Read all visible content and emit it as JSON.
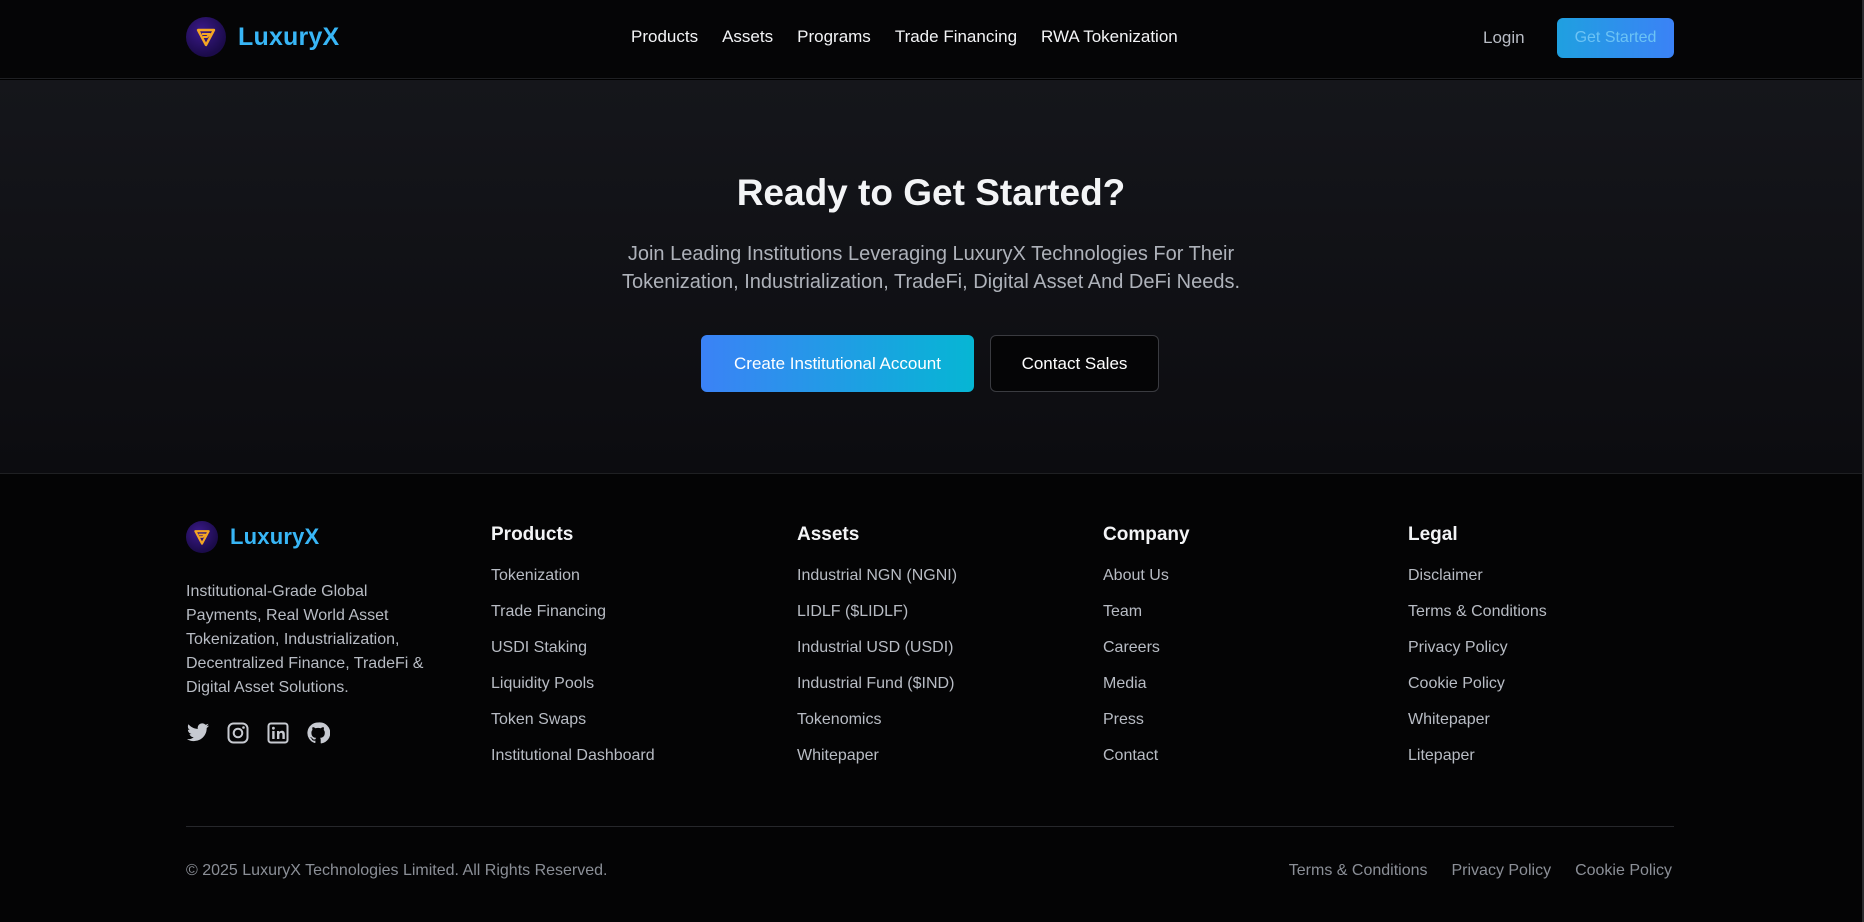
{
  "brand": {
    "name": "LuxuryX",
    "color": "#38b6f6"
  },
  "nav": {
    "items": [
      "Products",
      "Assets",
      "Programs",
      "Trade Financing",
      "RWA Tokenization"
    ],
    "login": "Login",
    "get_started": "Get Started"
  },
  "hero": {
    "title": "Ready to Get Started?",
    "subtitle_line1": "Join Leading Institutions Leveraging LuxuryX Technologies For Their",
    "subtitle_line2": "Tokenization, Industrialization, TradeFi, Digital Asset And DeFi Needs.",
    "primary_cta": "Create Institutional Account",
    "secondary_cta": "Contact Sales"
  },
  "footer": {
    "brand_name": "LuxuryX",
    "description": "Institutional-Grade Global Payments, Real World Asset Tokenization, Industrialization, Decentralized Finance, TradeFi & Digital Asset Solutions.",
    "social_icons": [
      "twitter-icon",
      "instagram-icon",
      "linkedin-icon",
      "github-icon"
    ],
    "columns": [
      {
        "title": "Products",
        "links": [
          "Tokenization",
          "Trade Financing",
          "USDI Staking",
          "Liquidity Pools",
          "Token Swaps",
          "Institutional Dashboard"
        ]
      },
      {
        "title": "Assets",
        "links": [
          "Industrial NGN (NGNI)",
          "LIDLF ($LIDLF)",
          "Industrial USD (USDI)",
          "Industrial Fund ($IND)",
          "Tokenomics",
          "Whitepaper"
        ]
      },
      {
        "title": "Company",
        "links": [
          "About Us",
          "Team",
          "Careers",
          "Media",
          "Press",
          "Contact"
        ]
      },
      {
        "title": "Legal",
        "links": [
          "Disclaimer",
          "Terms & Conditions",
          "Privacy Policy",
          "Cookie Policy",
          "Whitepaper",
          "Litepaper"
        ]
      }
    ],
    "copyright": "© 2025 LuxuryX Technologies Limited. All Rights Reserved.",
    "bottom_links": [
      "Terms & Conditions",
      "Privacy Policy",
      "Cookie Policy"
    ]
  },
  "colors": {
    "accent_blue": "#3b82f6",
    "accent_cyan": "#06b6d4"
  }
}
